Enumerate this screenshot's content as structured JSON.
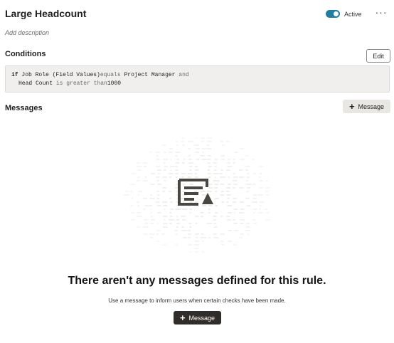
{
  "header": {
    "title": "Large Headcount",
    "toggle_label": "Active",
    "toggle_on": true,
    "more_glyph": "···",
    "add_description": "Add description"
  },
  "conditions": {
    "label": "Conditions",
    "edit_label": "Edit",
    "line1": {
      "kw": "if",
      "field": "Job Role (Field Values)",
      "op": "equals",
      "value": "Project Manager",
      "join": "and"
    },
    "line2": {
      "field": "Head Count",
      "op": "is greater than",
      "value": "1000"
    }
  },
  "messages": {
    "label": "Messages",
    "add_label": "Message",
    "plus_glyph": "+",
    "empty_title": "There aren't any messages defined for this rule.",
    "empty_subtitle": "Use a message to inform users when certain checks have been made.",
    "empty_add_label": "Message"
  },
  "colors": {
    "toggle_accent": "#227e9e",
    "primary_button": "#312d2a",
    "secondary_button": "#e9e7e4",
    "condition_bg": "#f1efed",
    "illustration_dash": "#d4d2cf",
    "icon_dark": "#4a4642"
  }
}
